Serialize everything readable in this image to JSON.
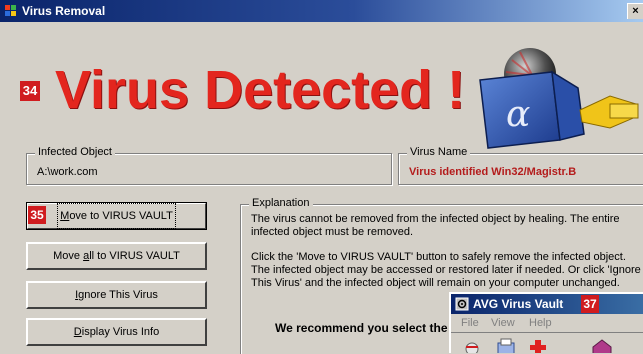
{
  "window": {
    "title": "Virus Removal",
    "close_glyph": "×"
  },
  "headline": {
    "badge": "34",
    "text": "Virus Detected !"
  },
  "infected_object": {
    "legend": "Infected Object",
    "value": "A:\\work.com"
  },
  "virus_name": {
    "legend": "Virus Name",
    "value": "Virus identified Win32/Magistr.B"
  },
  "buttons": {
    "move_badge": "35",
    "move_prefix": "",
    "move_mnemonic": "M",
    "move_rest": "ove to VIRUS VAULT",
    "move_all_prefix": "Move ",
    "move_all_mnemonic": "a",
    "move_all_rest": "ll to VIRUS VAULT",
    "ignore_prefix": "",
    "ignore_mnemonic": "I",
    "ignore_rest": "gnore This Virus",
    "display_prefix": "",
    "display_mnemonic": "D",
    "display_rest": "isplay Virus Info"
  },
  "explanation": {
    "legend": "Explanation",
    "para1": "The virus cannot be removed from the infected object by healing. The entire infected object must be removed.",
    "para2": "Click the 'Move to VIRUS VAULT' button to safely remove the infected object. The infected object may be accessed or restored later if needed. Or click 'Ignore This Virus' and the infected object will remain on your computer unchanged.",
    "recommend": "We recommend you select the"
  },
  "vault": {
    "title": "AVG Virus Vault",
    "badge": "37",
    "menu": [
      "File",
      "View",
      "Help"
    ]
  },
  "colors": {
    "headline_red": "#e3261e",
    "badge_red": "#d01c1f",
    "titlebar_blue": "#0a246a",
    "virus_name_red": "#b41c1c"
  },
  "icons": [
    "windows-flag-icon",
    "close-icon",
    "avg-logo-icon",
    "vault-app-icon",
    "vault-tool-icon"
  ]
}
